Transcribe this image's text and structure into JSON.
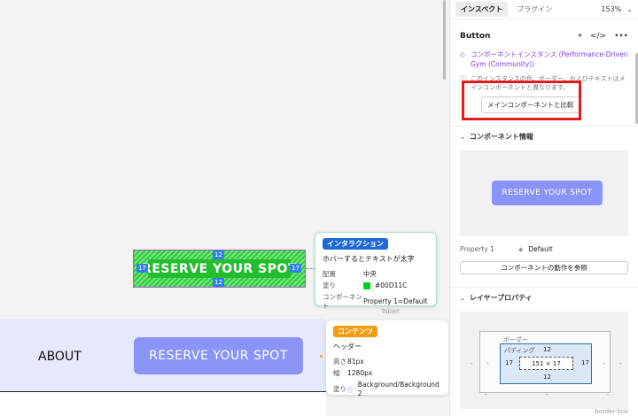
{
  "panel": {
    "tabs": [
      "インスペクト",
      "プラグイン"
    ],
    "zoom": "153%",
    "component_title": "Button",
    "instance_text": "コンポーネントインスタンス (Performance-Driven Gym (Community))",
    "info_text": "このインスタンスの色、ボーダー、およびテキストはメインコンポーネントと異なります。",
    "compare_button": "メインコンポーネントと比較",
    "component_info_title": "コンポーネント情報",
    "preview_button": "RESERVE YOUR SPOT",
    "property_key": "Property 1",
    "property_value": "Default",
    "reference_button": "コンポーネントの動作を参照",
    "layer_props_title": "レイヤープロパティ",
    "box": {
      "border_label": "ボーダー",
      "padding_label": "パディング",
      "pad_top": "12",
      "pad_bottom": "12",
      "pad_left": "17",
      "pad_right": "17",
      "size": "151 × 17",
      "dash": "-",
      "box_sizing": "border-box"
    },
    "accent_color": "#7b3fe4",
    "highlight_color": "#e01b1b"
  },
  "canvas": {
    "selected_button_text": "RESERVE YOUR SPOT",
    "badges": {
      "top": "12",
      "bottom": "12",
      "left": "17",
      "right": "17"
    },
    "selected_fill": "#00D11C",
    "interaction_tooltip": {
      "tag": "インタラクション",
      "description": "ホバーするとテキストが太字",
      "rows": [
        {
          "key": "配置",
          "value": "中央"
        },
        {
          "key": "塗り",
          "value": "#00D11C"
        },
        {
          "key": "コンポーネント",
          "value": "Property 1=Default"
        }
      ]
    },
    "tablet_label": "Tablet",
    "content_tooltip": {
      "tag": "コンテンツ",
      "name": "ヘッダー",
      "rows": [
        {
          "key": "高さ",
          "value": "81px"
        },
        {
          "key": "幅",
          "value": "1280px"
        },
        {
          "key": "塗り",
          "value": "Background/Background 2"
        }
      ]
    },
    "about_label": "ABOUT",
    "reserve_button": "RESERVE YOUR SPOT"
  }
}
